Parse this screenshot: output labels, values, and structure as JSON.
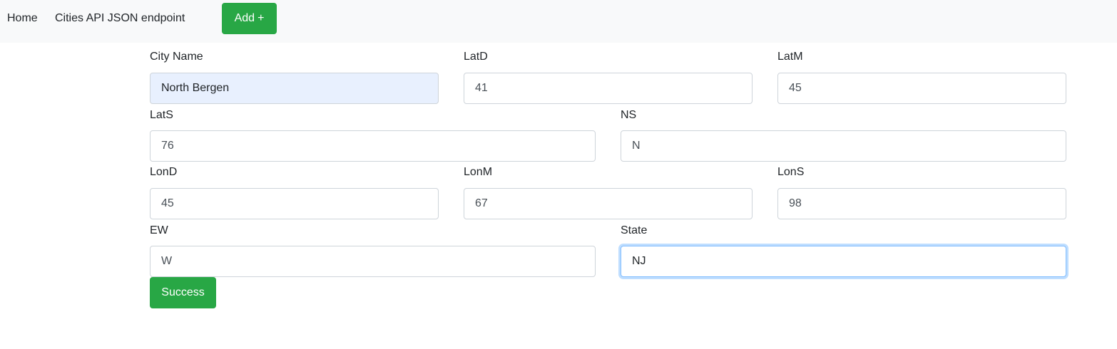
{
  "nav": {
    "home": "Home",
    "api": "Cities API JSON endpoint",
    "add_label": "Add",
    "add_icon": "+"
  },
  "form": {
    "city_name": {
      "label": "City Name",
      "value": "North Bergen"
    },
    "latd": {
      "label": "LatD",
      "value": "41"
    },
    "latm": {
      "label": "LatM",
      "value": "45"
    },
    "lats": {
      "label": "LatS",
      "value": "76"
    },
    "ns": {
      "label": "NS",
      "value": "N"
    },
    "lond": {
      "label": "LonD",
      "value": "45"
    },
    "lonm": {
      "label": "LonM",
      "value": "67"
    },
    "lons": {
      "label": "LonS",
      "value": "98"
    },
    "ew": {
      "label": "EW",
      "value": "W"
    },
    "state": {
      "label": "State",
      "value": "NJ"
    },
    "submit_label": "Success"
  },
  "colors": {
    "accent": "#28a745",
    "navbar_bg": "#f8f9fa",
    "autofill_bg": "#e8f0fe",
    "focus_border": "#80bdff"
  }
}
